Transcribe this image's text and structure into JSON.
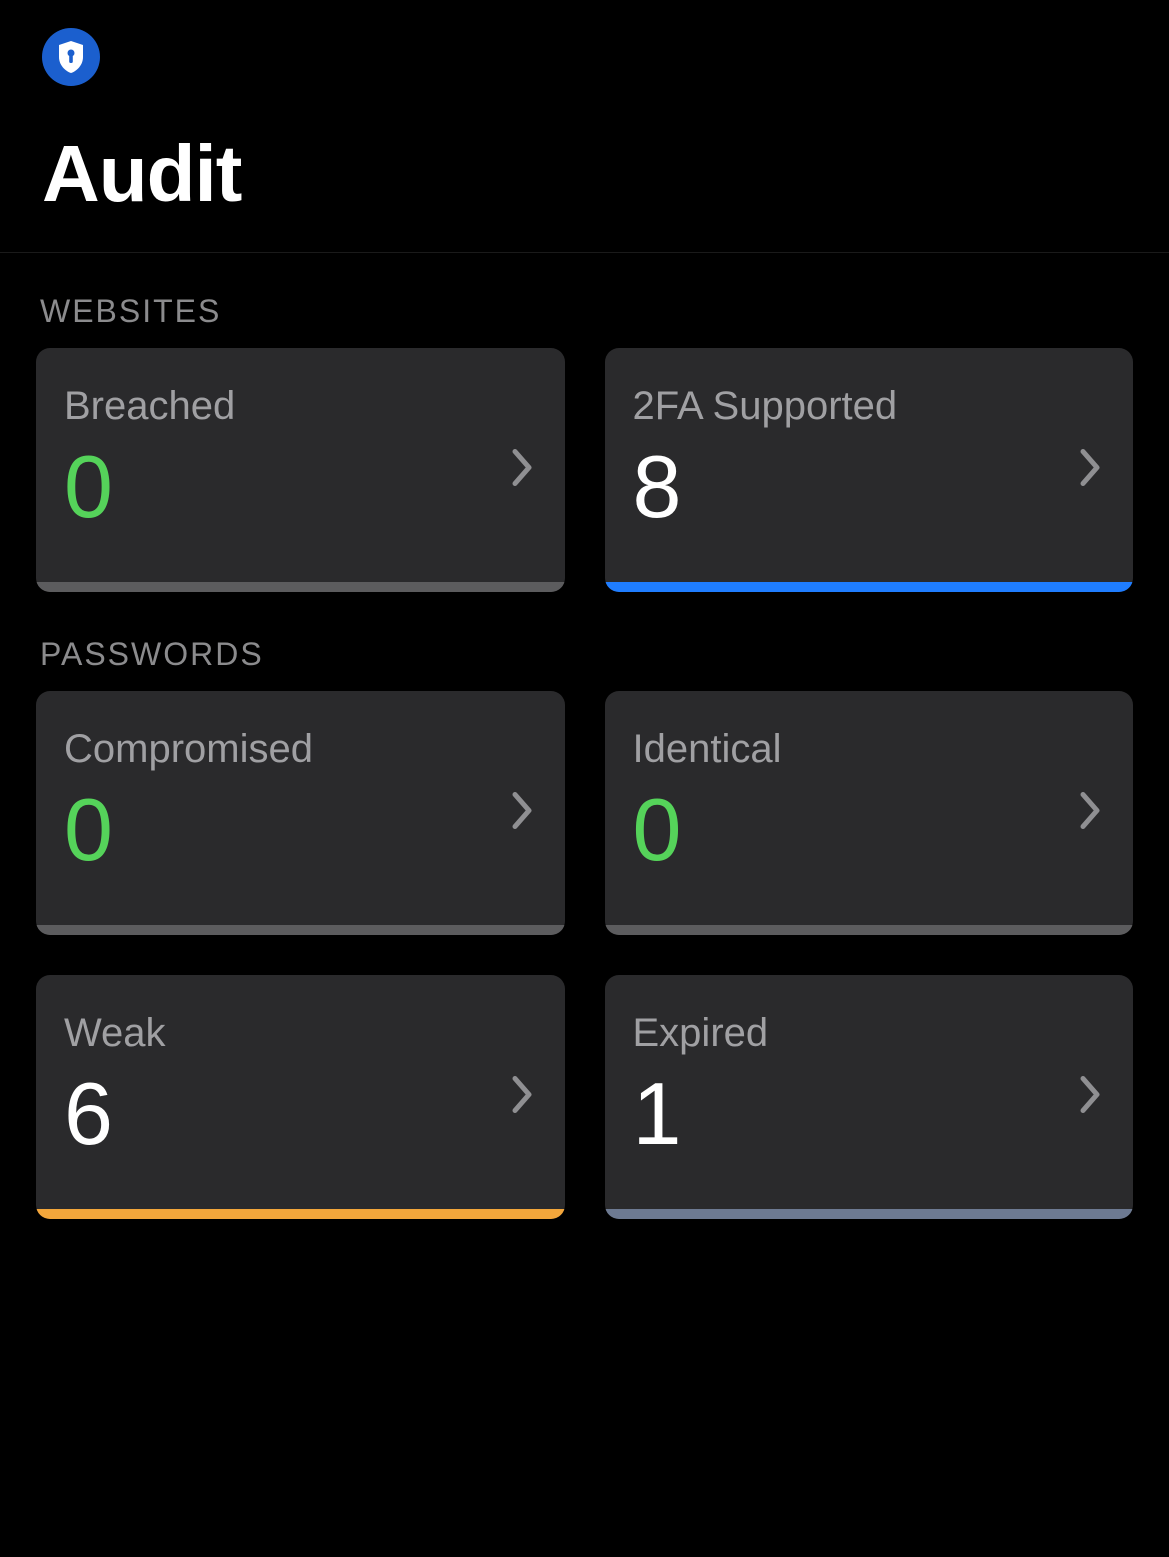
{
  "header": {
    "title": "Audit"
  },
  "sections": {
    "websites": {
      "label": "WEBSITES",
      "cards": {
        "breached": {
          "label": "Breached",
          "value": "0",
          "value_color": "green",
          "accent": "gray"
        },
        "twofa": {
          "label": "2FA Supported",
          "value": "8",
          "value_color": "white",
          "accent": "blue"
        }
      }
    },
    "passwords": {
      "label": "PASSWORDS",
      "cards": {
        "compromised": {
          "label": "Compromised",
          "value": "0",
          "value_color": "green",
          "accent": "gray"
        },
        "identical": {
          "label": "Identical",
          "value": "0",
          "value_color": "green",
          "accent": "gray"
        },
        "weak": {
          "label": "Weak",
          "value": "6",
          "value_color": "white",
          "accent": "orange"
        },
        "expired": {
          "label": "Expired",
          "value": "1",
          "value_color": "white",
          "accent": "slate"
        }
      }
    }
  },
  "colors": {
    "green": "#55d35a",
    "white": "#ffffff",
    "gray": "#5c5c5e",
    "blue": "#1f7dff",
    "orange": "#f3a63b",
    "slate": "#6d7a92"
  }
}
